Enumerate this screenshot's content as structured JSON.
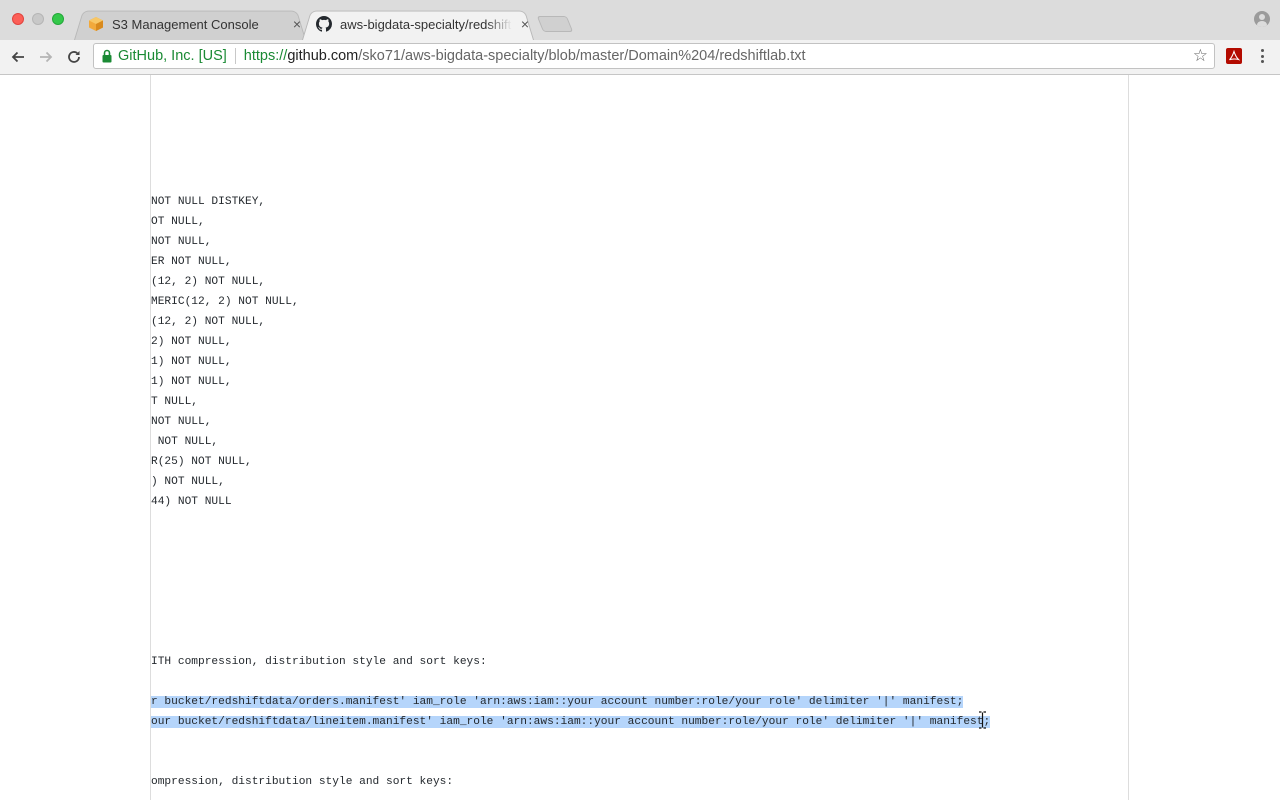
{
  "browser": {
    "tabs": [
      {
        "title": "S3 Management Console",
        "favicon": "aws-cube-icon",
        "active": false
      },
      {
        "title": "aws-bigdata-specialty/redshift",
        "favicon": "github-icon",
        "active": true
      }
    ],
    "tab_close_glyph": "×",
    "address_bar": {
      "security_label": "GitHub, Inc. [US]",
      "url_scheme": "https://",
      "url_host": "github.com",
      "url_path": "/sko71/aws-bigdata-specialty/blob/master/Domain%204/redshiftlab.txt"
    }
  },
  "file": {
    "lines": [
      {
        "text": "NOT NULL DISTKEY,",
        "selected": false
      },
      {
        "text": "OT NULL,",
        "selected": false
      },
      {
        "text": "NOT NULL,",
        "selected": false
      },
      {
        "text": "ER NOT NULL,",
        "selected": false
      },
      {
        "text": "(12, 2) NOT NULL,",
        "selected": false
      },
      {
        "text": "MERIC(12, 2) NOT NULL,",
        "selected": false
      },
      {
        "text": "(12, 2) NOT NULL,",
        "selected": false
      },
      {
        "text": "2) NOT NULL,",
        "selected": false
      },
      {
        "text": "1) NOT NULL,",
        "selected": false
      },
      {
        "text": "1) NOT NULL,",
        "selected": false
      },
      {
        "text": "T NULL,",
        "selected": false
      },
      {
        "text": "NOT NULL,",
        "selected": false
      },
      {
        "text": " NOT NULL,",
        "selected": false
      },
      {
        "text": "R(25) NOT NULL,",
        "selected": false
      },
      {
        "text": ") NOT NULL,",
        "selected": false
      },
      {
        "text": "44) NOT NULL",
        "selected": false
      },
      {
        "text": "",
        "selected": false
      },
      {
        "text": "",
        "selected": false
      },
      {
        "text": "",
        "selected": false
      },
      {
        "text": "",
        "selected": false
      },
      {
        "text": "",
        "selected": false
      },
      {
        "text": "",
        "selected": false
      },
      {
        "text": "",
        "selected": false
      },
      {
        "text": "ITH compression, distribution style and sort keys:",
        "selected": false
      },
      {
        "text": "",
        "selected": false
      },
      {
        "text": "r bucket/redshiftdata/orders.manifest' iam_role 'arn:aws:iam::your account number:role/your role' delimiter '|' manifest;",
        "selected": true
      },
      {
        "text": "our bucket/redshiftdata/lineitem.manifest' iam_role 'arn:aws:iam::your account number:role/your role' delimiter '|' manifest;",
        "selected": true
      },
      {
        "text": "",
        "selected": false
      },
      {
        "text": "",
        "selected": false
      },
      {
        "text": "ompression, distribution style and sort keys:",
        "selected": false
      }
    ]
  },
  "colors": {
    "selection": "#b5d5fb",
    "secure_green": "#1a8a34",
    "tabstrip": "#dcdcdc"
  }
}
